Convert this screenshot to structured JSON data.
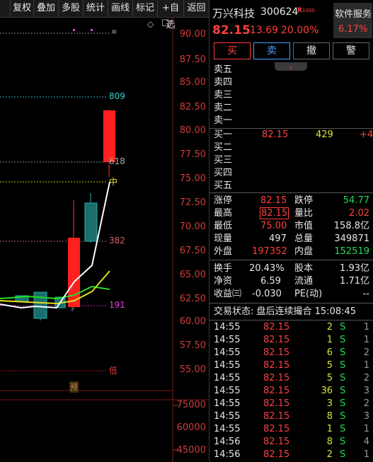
{
  "toolbar": {
    "items": [
      "复权",
      "叠加",
      "多股",
      "统计",
      "画线",
      "标记",
      "+自选",
      "返回"
    ],
    "diamond_glyph": "◇",
    "square_glyph": "☐"
  },
  "chart": {
    "price_axis": [
      "90.00",
      "87.50",
      "85.00",
      "82.50",
      "80.00",
      "77.50",
      "75.00",
      "72.50",
      "70.00",
      "67.50",
      "65.00",
      "62.50",
      "60.00",
      "57.50",
      "55.00"
    ],
    "volume_axis": [
      "75000",
      "60000",
      "45000"
    ],
    "markers": {
      "m809": "809",
      "m618": "618",
      "mid": "中",
      "m382": "382",
      "m191": "191",
      "low": "低",
      "yu": "预",
      "top_mark": "≡"
    }
  },
  "stock": {
    "name": "万兴科技",
    "code": "300624",
    "tag": "R",
    "tag_num": "1000",
    "service_label": "软件服务",
    "service_pct": "6.17%",
    "price": "82.15",
    "change": "13.69",
    "change_pct": "20.00%"
  },
  "buttons": {
    "buy": "买",
    "sell": "卖",
    "cancel": "撤",
    "alert": "警"
  },
  "orderbook": {
    "asks": [
      {
        "label": "卖五",
        "price": "",
        "vol": ""
      },
      {
        "label": "卖四",
        "price": "",
        "vol": ""
      },
      {
        "label": "卖三",
        "price": "",
        "vol": ""
      },
      {
        "label": "卖二",
        "price": "",
        "vol": ""
      },
      {
        "label": "卖一",
        "price": "",
        "vol": ""
      }
    ],
    "bids": [
      {
        "label": "买一",
        "price": "82.15",
        "vol": "429",
        "delta": "+4"
      },
      {
        "label": "买二",
        "price": "",
        "vol": "",
        "delta": ""
      },
      {
        "label": "买三",
        "price": "",
        "vol": "",
        "delta": ""
      },
      {
        "label": "买四",
        "price": "",
        "vol": "",
        "delta": ""
      },
      {
        "label": "买五",
        "price": "",
        "vol": "",
        "delta": ""
      }
    ]
  },
  "stats": {
    "limit_up_label": "涨停",
    "limit_up": "82.15",
    "limit_down_label": "跌停",
    "limit_down": "54.77",
    "high_label": "最高",
    "high": "82.15",
    "vol_ratio_label": "量比",
    "vol_ratio": "2.02",
    "low_label": "最低",
    "low": "75.00",
    "mktcap_label": "市值",
    "mktcap": "158.8亿",
    "cur_vol_label": "现量",
    "cur_vol": "497",
    "total_vol_label": "总量",
    "total_vol": "349871",
    "outer_label": "外盘",
    "outer": "197352",
    "inner_label": "内盘",
    "inner": "152519",
    "turnover_label": "换手",
    "turnover": "20.43%",
    "equity_label": "股本",
    "equity": "1.93亿",
    "nav_label": "净资",
    "nav": "6.59",
    "float_label": "流通",
    "float": "1.71亿",
    "eps_label": "收益㈢",
    "eps": "-0.030",
    "pe_label": "PE(动)",
    "pe": "--"
  },
  "trade_status": "交易状态: 盘后连续撮合 15:08:45",
  "ticks": [
    {
      "time": "14:55",
      "price": "82.15",
      "vol": "2",
      "side": "S",
      "num": "1"
    },
    {
      "time": "14:55",
      "price": "82.15",
      "vol": "1",
      "side": "S",
      "num": "1"
    },
    {
      "time": "14:55",
      "price": "82.15",
      "vol": "6",
      "side": "S",
      "num": "2"
    },
    {
      "time": "14:55",
      "price": "82.15",
      "vol": "5",
      "side": "S",
      "num": "1"
    },
    {
      "time": "14:55",
      "price": "82.15",
      "vol": "5",
      "side": "S",
      "num": "2"
    },
    {
      "time": "14:55",
      "price": "82.15",
      "vol": "36",
      "side": "S",
      "num": "3"
    },
    {
      "time": "14:55",
      "price": "82.15",
      "vol": "3",
      "side": "S",
      "num": "2"
    },
    {
      "time": "14:55",
      "price": "82.15",
      "vol": "8",
      "side": "S",
      "num": "3"
    },
    {
      "time": "14:55",
      "price": "82.15",
      "vol": "1",
      "side": "S",
      "num": "1"
    },
    {
      "time": "14:56",
      "price": "82.15",
      "vol": "8",
      "side": "S",
      "num": "4"
    },
    {
      "time": "14:56",
      "price": "82.15",
      "vol": "2",
      "side": "S",
      "num": "1"
    }
  ],
  "colors": {
    "up": "#ff4040",
    "down": "#22dd55",
    "panel_border": "#3a3a3a"
  }
}
